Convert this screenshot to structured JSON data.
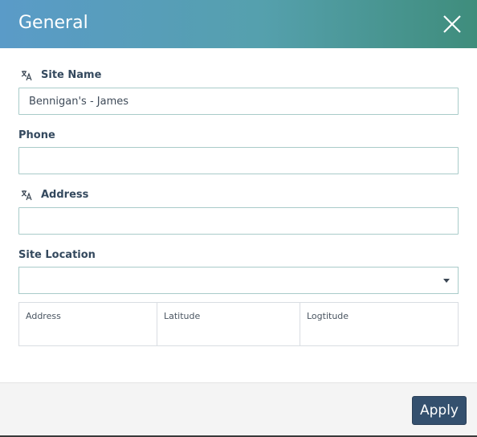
{
  "dialog": {
    "title": "General",
    "close_icon": "close-icon"
  },
  "fields": {
    "site_name": {
      "label": "Site Name",
      "value": "Bennigan's - James",
      "icon": "translate-icon"
    },
    "phone": {
      "label": "Phone",
      "value": ""
    },
    "address": {
      "label": "Address",
      "value": "",
      "icon": "translate-icon"
    },
    "site_location": {
      "label": "Site Location",
      "selected": ""
    }
  },
  "location_table": {
    "columns": [
      "Address",
      "Latitude",
      "Logtitude"
    ]
  },
  "footer": {
    "apply_label": "Apply"
  },
  "colors": {
    "header_gradient_start": "#5a9bc8",
    "header_gradient_end": "#3f8d7c",
    "input_border": "#a9cbc9",
    "apply_button": "#34506e"
  }
}
